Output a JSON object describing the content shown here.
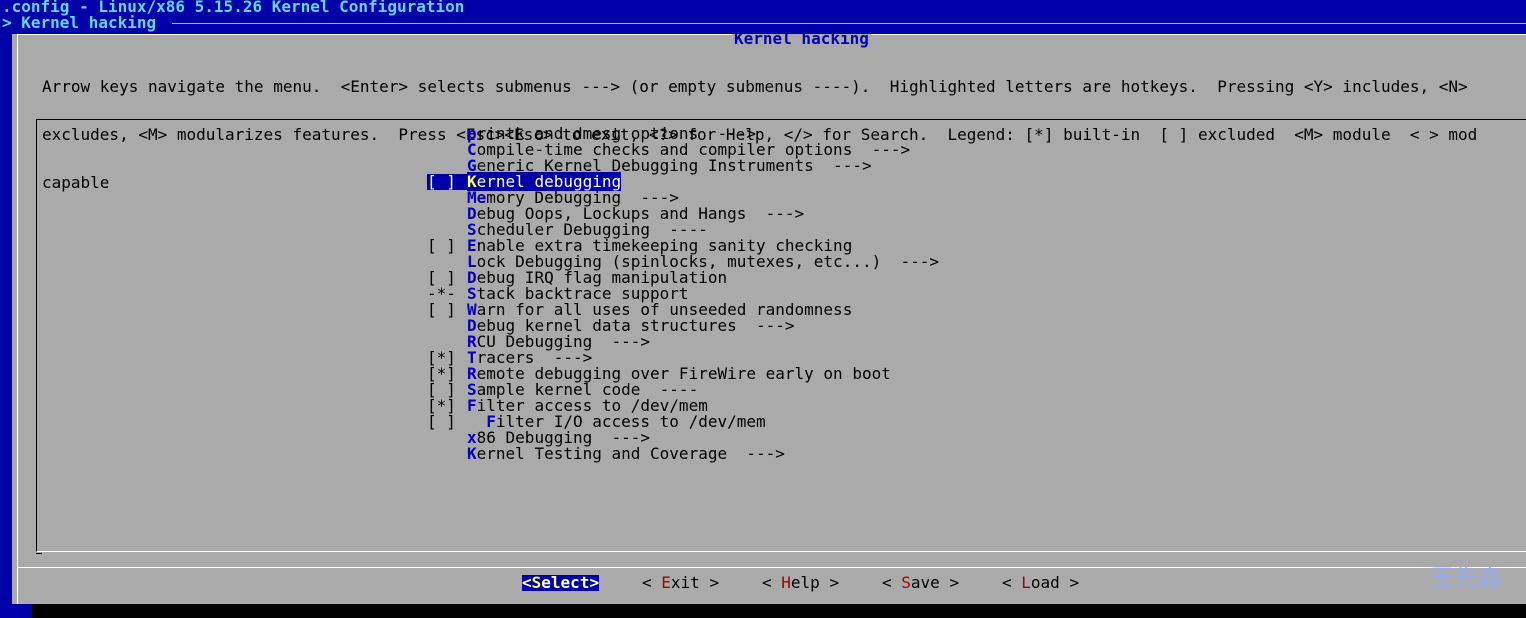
{
  "window": {
    "title": ".config - Linux/x86 5.15.26 Kernel Configuration",
    "breadcrumb": "> Kernel hacking"
  },
  "dialog": {
    "title": "Kernel hacking",
    "help_lines": [
      "Arrow keys navigate the menu.  <Enter> selects submenus ---> (or empty submenus ----).  Highlighted letters are hotkeys.  Pressing <Y> includes, <N>",
      "excludes, <M> modularizes features.  Press <Esc><Esc> to exit, <?> for Help, </> for Search.  Legend: [*] built-in  [ ] excluded  <M> module  < > mod",
      "capable"
    ]
  },
  "menu": {
    "items": [
      {
        "prefix": "    ",
        "hot": "p",
        "rest": "rintk and dmesg options  --->"
      },
      {
        "prefix": "    ",
        "hot": "C",
        "rest": "ompile-time checks and compiler options  --->"
      },
      {
        "prefix": "    ",
        "hot": "G",
        "rest": "eneric Kernel Debugging Instruments  --->"
      },
      {
        "prefix": "[ ] ",
        "hot": "K",
        "rest": "ernel debugging"
      },
      {
        "prefix": "    ",
        "hot": "Me",
        "rest": "mory Debugging  --->"
      },
      {
        "prefix": "    ",
        "hot": "D",
        "rest": "ebug Oops, Lockups and Hangs  --->"
      },
      {
        "prefix": "    ",
        "hot": "S",
        "rest": "cheduler Debugging  ----"
      },
      {
        "prefix": "[ ] ",
        "hot": "E",
        "rest": "nable extra timekeeping sanity checking"
      },
      {
        "prefix": "    ",
        "hot": "L",
        "rest": "ock Debugging (spinlocks, mutexes, etc...)  --->"
      },
      {
        "prefix": "[ ] ",
        "hot": "D",
        "rest": "ebug IRQ flag manipulation"
      },
      {
        "prefix": "-*- ",
        "hot": "S",
        "rest": "tack backtrace support"
      },
      {
        "prefix": "[ ] ",
        "hot": "W",
        "rest": "arn for all uses of unseeded randomness"
      },
      {
        "prefix": "    ",
        "hot": "D",
        "rest": "ebug kernel data structures  --->"
      },
      {
        "prefix": "    ",
        "hot": "R",
        "rest": "CU Debugging  --->"
      },
      {
        "prefix": "[*] ",
        "hot": "T",
        "rest": "racers  --->"
      },
      {
        "prefix": "[*] ",
        "hot": "R",
        "rest": "emote debugging over FireWire early on boot"
      },
      {
        "prefix": "[ ] ",
        "hot": "S",
        "rest": "ample kernel code  ----"
      },
      {
        "prefix": "[*] ",
        "hot": "F",
        "rest": "ilter access to /dev/mem"
      },
      {
        "prefix": "[ ] ",
        "hot": "  F",
        "rest": "ilter I/O access to /dev/mem"
      },
      {
        "prefix": "    ",
        "hot": "x",
        "rest": "86 Debugging  --->"
      },
      {
        "prefix": "    ",
        "hot": "K",
        "rest": "ernel Testing and Coverage  --->"
      }
    ],
    "selected_index": 3
  },
  "buttons": [
    {
      "pre": "<",
      "hot": "S",
      "post": "elect>",
      "selected": true
    },
    {
      "pre": "< ",
      "hot": "E",
      "post": "xit >",
      "selected": false
    },
    {
      "pre": "< ",
      "hot": "H",
      "post": "elp >",
      "selected": false
    },
    {
      "pre": "< ",
      "hot": "S",
      "post": "ave >",
      "selected": false
    },
    {
      "pre": "< ",
      "hot": "L",
      "post": "oad >",
      "selected": false
    }
  ],
  "watermark": "王先森",
  "colors": {
    "screen_bg": "#0000a8",
    "dialog_bg": "#aaaaaa",
    "hotkey": "#0000c0",
    "button_hotkey": "#a80000",
    "selection_bg": "#0000a8",
    "selected_hotkey": "#ffff55"
  }
}
